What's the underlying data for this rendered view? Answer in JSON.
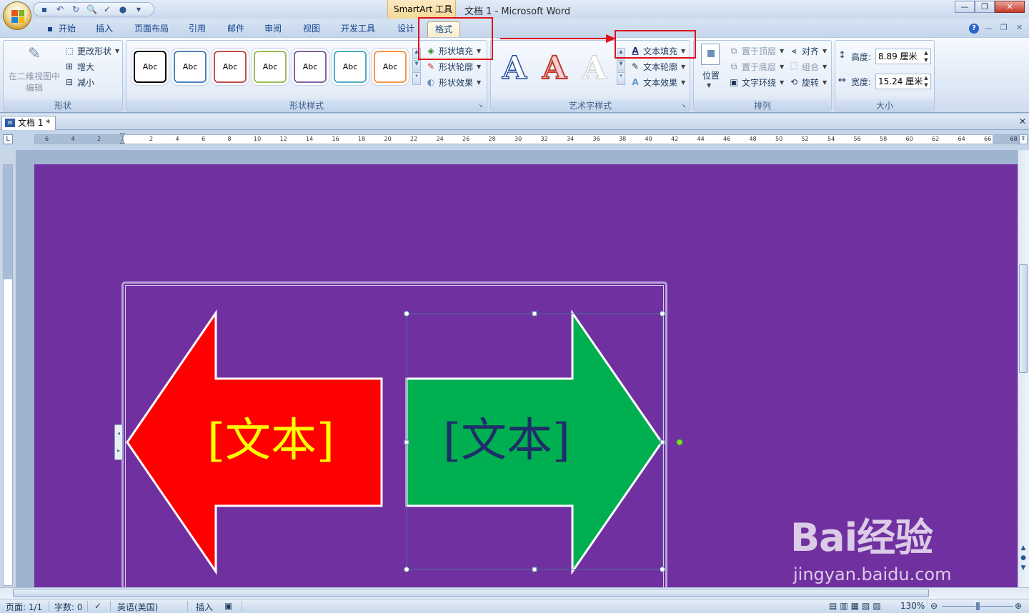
{
  "window": {
    "title": "文档 1 - Microsoft Word",
    "context_tool": "SmartArt 工具",
    "minimize": "—",
    "restore": "❐",
    "close": "✕"
  },
  "tabs": [
    "开始",
    "插入",
    "页面布局",
    "引用",
    "邮件",
    "审阅",
    "视图",
    "开发工具",
    "设计",
    "格式"
  ],
  "active_tab": "格式",
  "ribbon": {
    "shapes_group": {
      "label": "形状",
      "edit_2d": "在二维视图中编辑",
      "change_shape": "更改形状",
      "larger": "增大",
      "smaller": "减小"
    },
    "shape_styles_group": {
      "label": "形状样式",
      "thumbnails": [
        "Abc",
        "Abc",
        "Abc",
        "Abc",
        "Abc",
        "Abc",
        "Abc"
      ],
      "thumbnail_colors": [
        "#000000",
        "#4f81bd",
        "#c0504d",
        "#9bbb59",
        "#8064a2",
        "#4bacc6",
        "#f79646"
      ],
      "shape_fill": "形状填充",
      "shape_outline": "形状轮廓",
      "shape_effects": "形状效果"
    },
    "wordart_group": {
      "label": "艺术字样式",
      "samples": [
        "A",
        "A",
        "A"
      ],
      "text_fill": "文本填充",
      "text_outline": "文本轮廓",
      "text_effects": "文本效果"
    },
    "arrange_group": {
      "label": "排列",
      "position": "位置",
      "bring_front": "置于顶层",
      "send_back": "置于底层",
      "text_wrap": "文字环绕",
      "align": "对齐",
      "group": "组合",
      "rotate": "旋转"
    },
    "size_group": {
      "label": "大小",
      "height_label": "高度:",
      "height_value": "8.89 厘米",
      "width_label": "宽度:",
      "width_value": "15.24 厘米"
    }
  },
  "doc_tab": "文档 1 *",
  "ruler_numbers": [
    "6",
    "4",
    "2",
    "",
    "2",
    "4",
    "6",
    "8",
    "10",
    "12",
    "14",
    "16",
    "18",
    "20",
    "22",
    "24",
    "26",
    "28",
    "30",
    "32",
    "34",
    "36",
    "38",
    "40",
    "42",
    "44",
    "46",
    "48",
    "50",
    "52",
    "54",
    "56",
    "58",
    "60",
    "62",
    "64",
    "66",
    "68"
  ],
  "smartart": {
    "left_arrow_text": "[文本]",
    "right_arrow_text": "[文本]",
    "left_arrow_color": "#ff0000",
    "left_text_color": "#ffff00",
    "right_arrow_color": "#00b050",
    "right_text_color": "#1f2d6a",
    "page_color": "#7030a0"
  },
  "statusbar": {
    "page": "页面: 1/1",
    "words": "字数: 0",
    "language": "英语(美国)",
    "mode": "插入",
    "zoom": "130%"
  },
  "watermark": {
    "brand": "Bai经验",
    "url": "jingyan.baidu.com"
  }
}
